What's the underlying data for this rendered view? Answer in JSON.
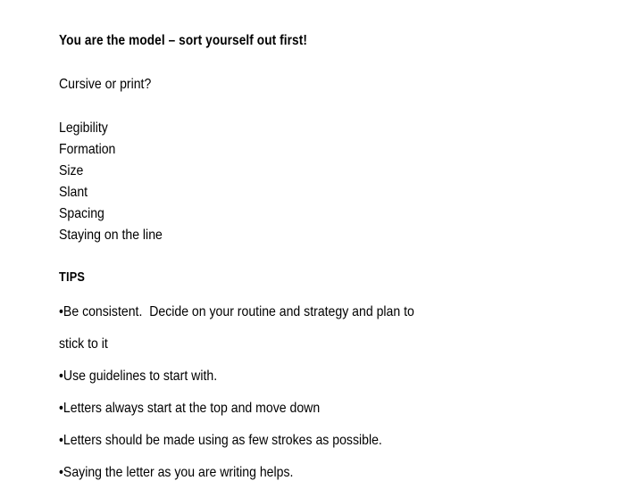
{
  "slide": {
    "title": "You are the model – sort yourself out first!",
    "subheading": "Cursive or print?",
    "aspects": [
      "Legibility",
      "Formation",
      "Size",
      "Slant",
      "Spacing",
      "Staying on the line"
    ],
    "tips_heading": "TIPS",
    "bullet_char": "•",
    "tips": [
      {
        "lines": [
          "•Be consistent.  Decide on your routine and strategy and plan to",
          "stick to it"
        ]
      },
      {
        "lines": [
          "•Use guidelines to start with."
        ]
      },
      {
        "lines": [
          "•Letters always start at the top and move down"
        ]
      },
      {
        "lines": [
          "•Letters should be made using as few strokes as possible."
        ]
      },
      {
        "lines": [
          "•Saying the letter as you are writing helps."
        ]
      }
    ]
  },
  "colors": {
    "background": "#ffffff",
    "text": "#000000"
  }
}
